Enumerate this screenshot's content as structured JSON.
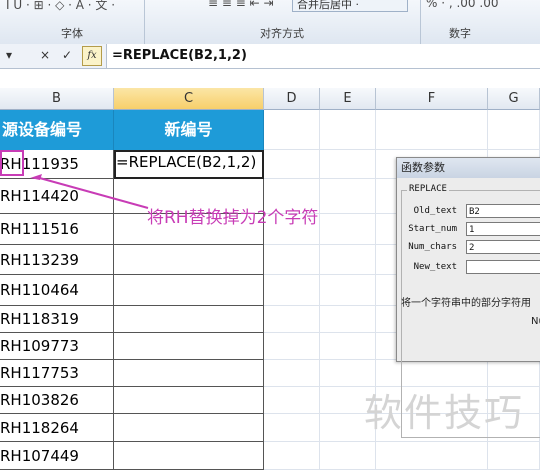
{
  "ribbon": {
    "groups": [
      {
        "label": "字体",
        "icons": "I  U  ·  ⊞ ·  ◇ · A ·  文 ·"
      },
      {
        "label": "对齐方式",
        "icons": "≡  ≡  ≡    ⇤  ⇥"
      },
      {
        "label": "数字",
        "icons": "% ·  ,   .00  .00"
      }
    ],
    "merge_label": "合并后居中 ·"
  },
  "formula_bar": {
    "name_box_arrow": "▾",
    "cancel": "×",
    "enter": "✓",
    "fx": "fx",
    "formula": "=REPLACE(B2,1,2)"
  },
  "columns": [
    "B",
    "C",
    "D",
    "E",
    "F",
    "G"
  ],
  "sheet": {
    "header_b": "源设备编号",
    "header_c": "新编号",
    "c2_formula": "=REPLACE(B2,1,2)",
    "rows": [
      "RH111935",
      "RH114420",
      "RH111516",
      "RH113239",
      "RH110464",
      "RH118319",
      "RH109773",
      "RH117753",
      "RH103826",
      "RH118264",
      "RH107449"
    ]
  },
  "annotation": {
    "text": "将RH替换掉为2个字符",
    "color": "#c83cb6"
  },
  "dialog": {
    "title": "函数参数",
    "function_name": "REPLACE",
    "args": [
      {
        "label": "Old_text",
        "value": "B2"
      },
      {
        "label": "Start_num",
        "value": "1"
      },
      {
        "label": "Num_chars",
        "value": "2"
      },
      {
        "label": "New_text",
        "value": ""
      }
    ],
    "description": "将一个字符串中的部分字符用",
    "partial_label": "Nu"
  },
  "watermark": "软件技巧",
  "colors": {
    "header_fill": "#1e9bd8",
    "selected_col": "#f7cf6b",
    "annotation": "#c83cb6"
  }
}
